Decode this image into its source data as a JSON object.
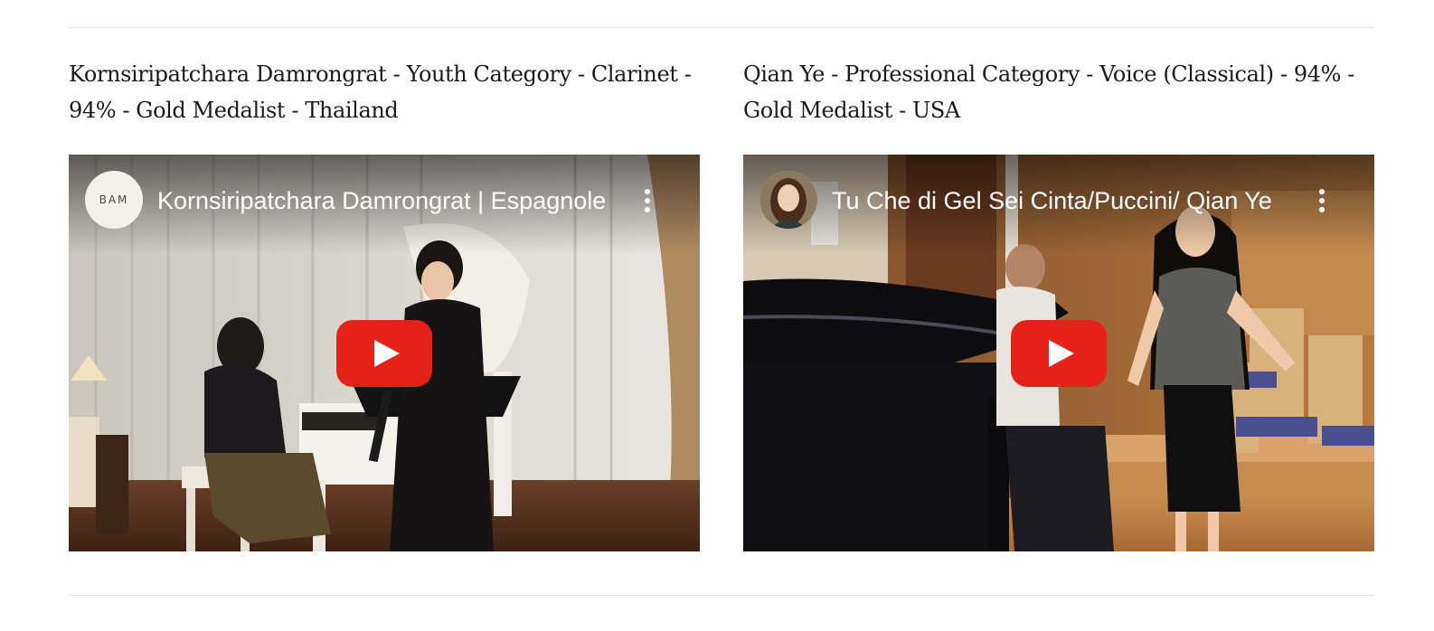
{
  "videos": [
    {
      "caption": "Kornsiripatchara Damrongrat - Youth Category - Clarinet  - 94% - Gold Medalist -  Thailand",
      "video_title": "Kornsiripatchara Damrongrat | Espagnole",
      "channel_avatar_text": "BAM"
    },
    {
      "caption": "Qian Ye - Professional Category - Voice (Classical) - 94% - Gold Medalist - USA",
      "video_title": "Tu Che di Gel Sei Cinta/Puccini/ Qian Ye",
      "channel_avatar_text": ""
    }
  ],
  "icons": {
    "play": "youtube-play-icon",
    "menu": "more-vertical-icon"
  },
  "colors": {
    "play_button": "#e62117",
    "caption_text": "#1a1a1a",
    "divider": "#e2e2e2"
  }
}
